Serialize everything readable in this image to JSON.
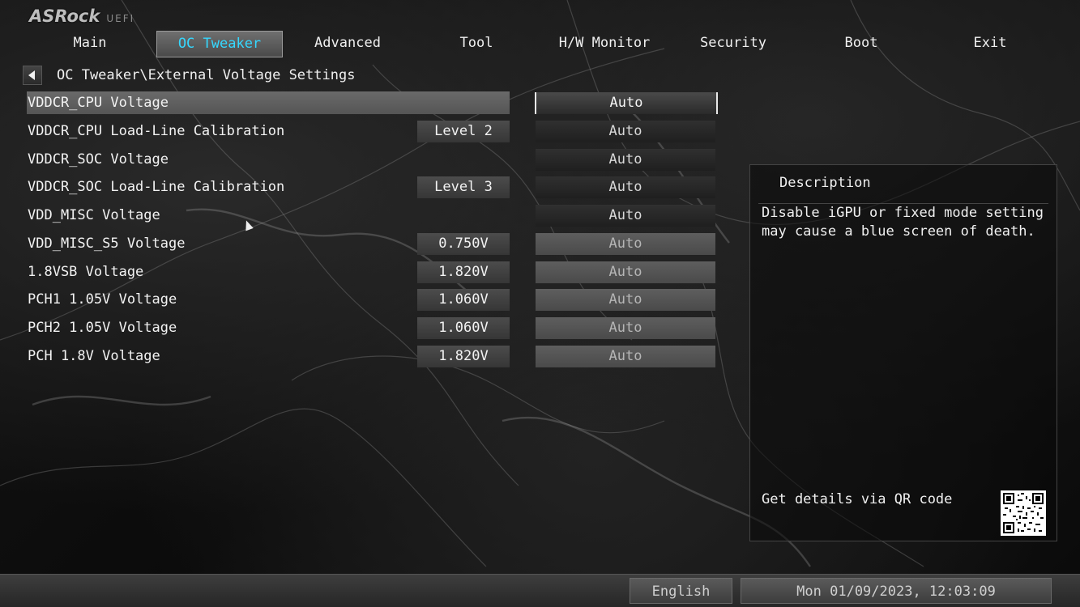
{
  "brand": {
    "logo": "ASRock",
    "suffix": "UEFI"
  },
  "nav": {
    "tabs": [
      {
        "label": "Main"
      },
      {
        "label": "OC Tweaker"
      },
      {
        "label": "Advanced"
      },
      {
        "label": "Tool"
      },
      {
        "label": "H/W Monitor"
      },
      {
        "label": "Security"
      },
      {
        "label": "Boot"
      },
      {
        "label": "Exit"
      }
    ],
    "active": "OC Tweaker"
  },
  "breadcrumb": "OC Tweaker\\External Voltage Settings",
  "settings": [
    {
      "label": "VDDCR_CPU Voltage",
      "current": "",
      "option": "Auto"
    },
    {
      "label": "VDDCR_CPU Load-Line Calibration",
      "current": "Level 2",
      "option": "Auto"
    },
    {
      "label": "VDDCR_SOC Voltage",
      "current": "",
      "option": "Auto"
    },
    {
      "label": "VDDCR_SOC Load-Line Calibration",
      "current": "Level 3",
      "option": "Auto"
    },
    {
      "label": "VDD_MISC Voltage",
      "current": "",
      "option": "Auto"
    },
    {
      "label": "VDD_MISC_S5 Voltage",
      "current": "0.750V",
      "option": "Auto"
    },
    {
      "label": "1.8VSB Voltage",
      "current": "1.820V",
      "option": "Auto"
    },
    {
      "label": "PCH1 1.05V Voltage",
      "current": "1.060V",
      "option": "Auto"
    },
    {
      "label": "PCH2 1.05V Voltage",
      "current": "1.060V",
      "option": "Auto"
    },
    {
      "label": "PCH 1.8V Voltage",
      "current": "1.820V",
      "option": "Auto"
    }
  ],
  "description": {
    "title": "Description",
    "text": "Disable iGPU or fixed mode setting may cause a blue screen of death.",
    "qr_label": "Get details via QR code"
  },
  "footer": {
    "language": "English",
    "datetime": "Mon 01/09/2023, 12:03:09"
  },
  "colors": {
    "active_tab_text": "#35d8ff",
    "background": "#111111",
    "text": "#f0f0f0"
  }
}
